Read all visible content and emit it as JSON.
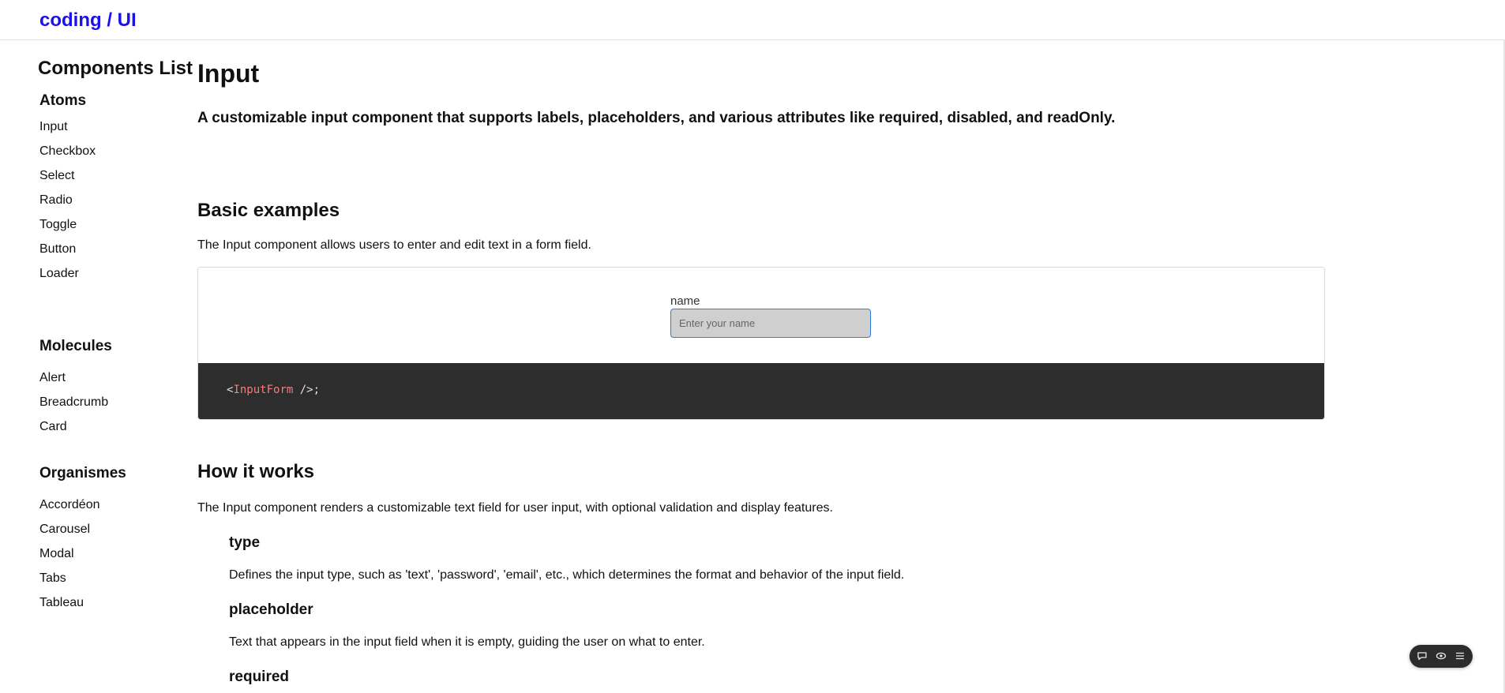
{
  "header": {
    "logo": "coding / UI"
  },
  "sidebar": {
    "title": "Components List",
    "groups": [
      {
        "title": "Atoms",
        "items": [
          "Input",
          "Checkbox",
          "Select",
          "Radio",
          "Toggle",
          "Button",
          "Loader"
        ]
      },
      {
        "title": "Molecules",
        "items": [
          "Alert",
          "Breadcrumb",
          "Card"
        ]
      },
      {
        "title": "Organismes",
        "items": [
          "Accordéon",
          "Carousel",
          "Modal",
          "Tabs",
          "Tableau"
        ]
      }
    ]
  },
  "main": {
    "title": "Input",
    "description": "A customizable input component that supports labels, placeholders, and various attributes like required, disabled, and readOnly.",
    "basic": {
      "heading": "Basic examples",
      "text": "The Input component allows users to enter and edit text in a form field.",
      "field_label": "name",
      "field_placeholder": "Enter your name",
      "code_open": "<",
      "code_tag": "InputForm",
      "code_close": " />;"
    },
    "how": {
      "heading": "How it works",
      "text": "The Input component renders a customizable text field for user input, with optional validation and display features.",
      "props": [
        {
          "name": "type",
          "desc": "Defines the input type, such as 'text', 'password', 'email', etc., which determines the format and behavior of the input field."
        },
        {
          "name": "placeholder",
          "desc": "Text that appears in the input field when it is empty, guiding the user on what to enter."
        },
        {
          "name": "required",
          "desc": ""
        }
      ]
    }
  },
  "floating_toolbar": {
    "icons": [
      "chat-icon",
      "eye-icon",
      "list-icon"
    ]
  },
  "colors": {
    "logo": "#1a12e8",
    "code_bg": "#2d2d2d",
    "code_tag": "#f07f7f",
    "input_border": "#2e7ed8"
  }
}
